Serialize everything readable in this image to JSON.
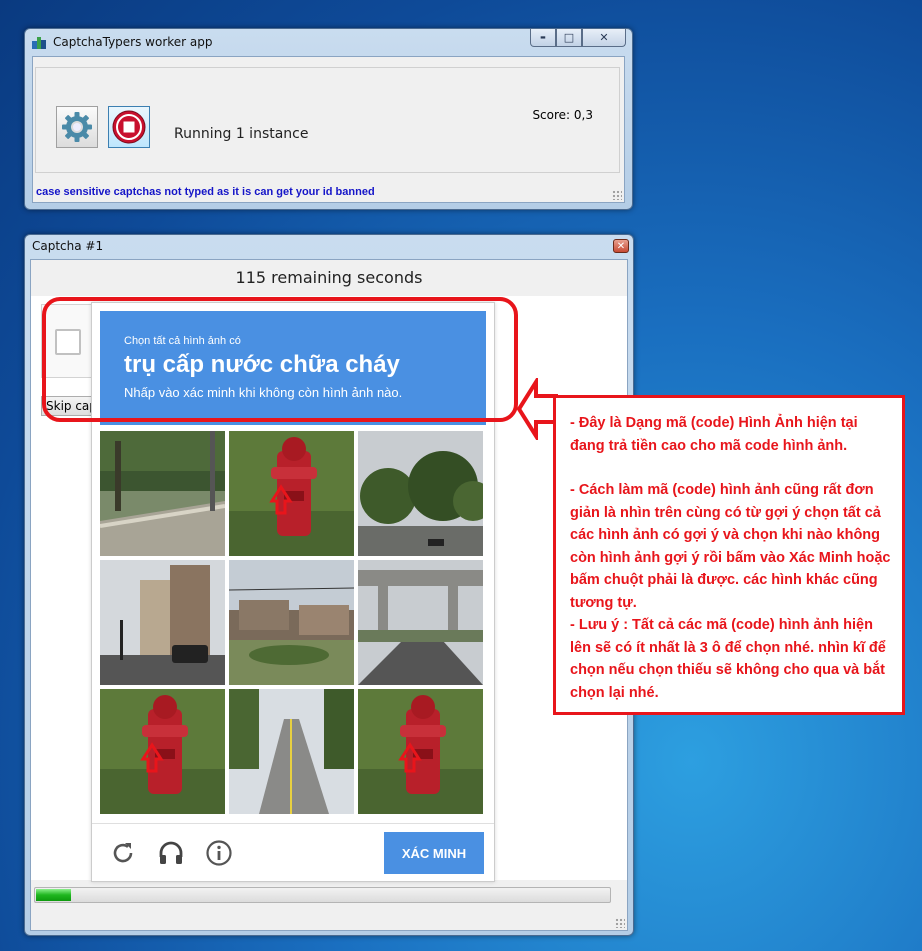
{
  "app_window": {
    "title": "CaptchaTypers worker app",
    "status": "Running 1 instance",
    "score": "Score: 0,3",
    "warning": "case sensitive captchas not typed as it is can get your id banned",
    "caption_buttons": {
      "minimize": "▬",
      "maximize": "□",
      "close": "✕"
    }
  },
  "captcha_window": {
    "title": "Captcha #1",
    "close_glyph": "✕",
    "timer": "115 remaining seconds",
    "skip_label": "Skip captcha",
    "challenge": {
      "pretext": "Chọn tất cả hình ảnh có",
      "target": "trụ cấp nước chữa cháy",
      "instruction": "Nhấp vào xác minh khi không còn hình ảnh nào.",
      "verify_label": "XÁC MINH",
      "tiles": [
        {
          "scene": "park-path",
          "marked": false
        },
        {
          "scene": "hydrant",
          "marked": true
        },
        {
          "scene": "trees-road",
          "marked": false
        },
        {
          "scene": "city-intersection",
          "marked": false
        },
        {
          "scene": "apartments",
          "marked": false
        },
        {
          "scene": "overpass",
          "marked": false
        },
        {
          "scene": "hydrant",
          "marked": true
        },
        {
          "scene": "empty-road",
          "marked": false
        },
        {
          "scene": "hydrant",
          "marked": true
        }
      ],
      "footer_icons": [
        "reload-icon",
        "headphones-icon",
        "info-icon"
      ]
    },
    "progress_fraction": 0.06
  },
  "annotation": {
    "lines": [
      "- Đây là Dạng mã (code) Hình Ảnh hiện tại đang trả tiền cao cho mã code hình ảnh.",
      "- Cách làm mã (code) hình ảnh cũng rất đơn giản là nhìn trên cùng có từ gợi ý chọn tất cả các hình ảnh có  gợi ý   và chọn khi nào không còn hình ảnh  gợi ý   rồi bấm vào Xác Minh hoặc bấm chuột phải là được. các hình khác cũng tương tự.",
      "- Lưu ý : Tất cả các mã (code) hình ảnh hiện lên sẽ có ít nhất là 3 ô để chọn nhé. nhìn kĩ để chọn nếu chọn thiếu sẽ không cho qua và bắt chọn lại nhé."
    ],
    "accent_color": "#e8151b"
  }
}
